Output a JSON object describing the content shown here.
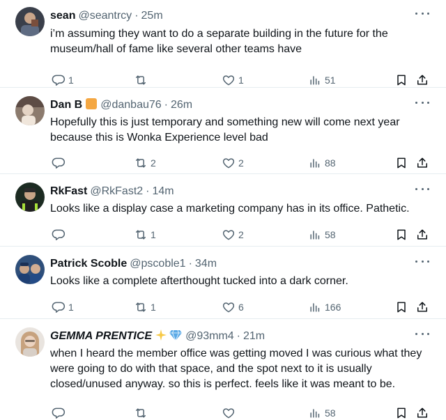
{
  "tweets": [
    {
      "name": "sean",
      "name_italic": false,
      "handle": "@seantrcy",
      "separator": "·",
      "time": "25m",
      "badge": "",
      "text": "i’m assuming they want to do a separate building in the future for the museum/hall of fame like several other teams have",
      "replies": "1",
      "retweets": "",
      "likes": "1",
      "views": "51"
    },
    {
      "name": "Dan B",
      "name_italic": false,
      "handle": "@danbau76",
      "separator": "·",
      "time": "26m",
      "badge": "orange-square",
      "text": "Hopefully this is just temporary and something new will come next year because this is Wonka Experience level bad",
      "replies": "",
      "retweets": "2",
      "likes": "2",
      "views": "88"
    },
    {
      "name": "RkFast",
      "name_italic": false,
      "handle": "@RkFast2",
      "separator": "·",
      "time": "14m",
      "badge": "",
      "text": "Looks like a display case a marketing company has in its office.  Pathetic.",
      "replies": "",
      "retweets": "1",
      "likes": "2",
      "views": "58"
    },
    {
      "name": "Patrick Scoble",
      "name_italic": false,
      "handle": "@pscoble1",
      "separator": "·",
      "time": "34m",
      "badge": "",
      "text": "Looks like a complete afterthought tucked into a dark corner.",
      "replies": "1",
      "retweets": "1",
      "likes": "6",
      "views": "166"
    },
    {
      "name": "GEMMA PRENTICE",
      "name_italic": true,
      "handle": "@93mm4",
      "separator": "·",
      "time": "21m",
      "badge": "sparkles-gem",
      "text": "when I heard the member office was getting moved I was curious what they were going to do with that space, and the spot next to it is usually closed/unused anyway. so this is perfect. feels like it was meant to be.",
      "replies": "",
      "retweets": "",
      "likes": "",
      "views": "58"
    }
  ],
  "colors": {
    "text": "#0f1419",
    "secondary": "#536471",
    "divider": "#e6ecf0",
    "badge_orange": "#f4a742",
    "gem_blue": "#5aa9e6",
    "sparkle_yellow": "#f7c945"
  }
}
